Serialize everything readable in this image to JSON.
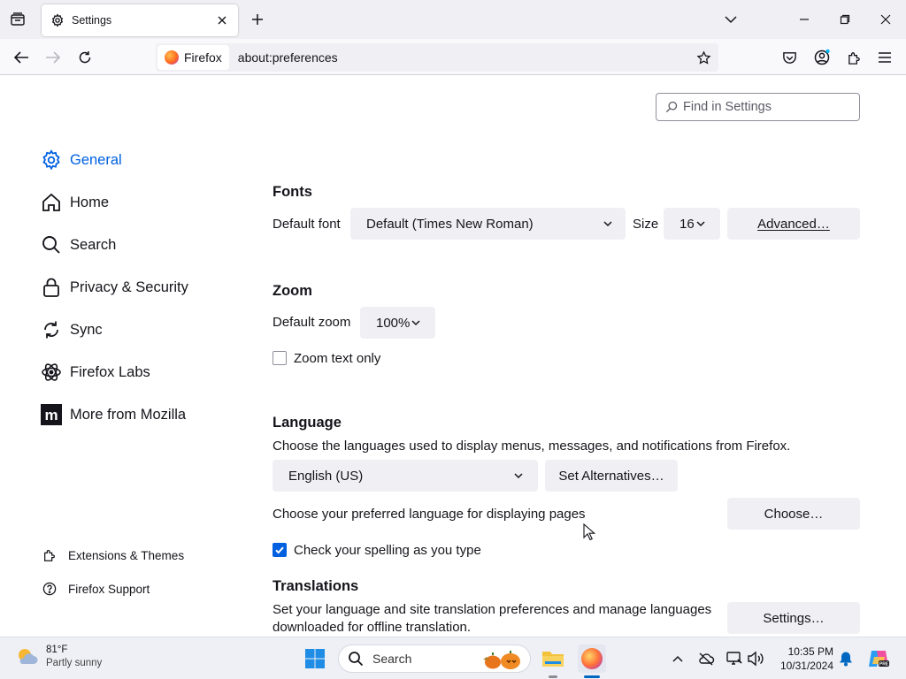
{
  "tab": {
    "title": "Settings"
  },
  "navbar": {
    "identity_label": "Firefox",
    "url": "about:preferences"
  },
  "search": {
    "placeholder": "Find in Settings"
  },
  "sidebar": {
    "categories": [
      {
        "label": "General",
        "icon": "gear-icon"
      },
      {
        "label": "Home",
        "icon": "home-icon"
      },
      {
        "label": "Search",
        "icon": "search-icon"
      },
      {
        "label": "Privacy & Security",
        "icon": "lock-icon"
      },
      {
        "label": "Sync",
        "icon": "sync-icon"
      },
      {
        "label": "Firefox Labs",
        "icon": "labs-icon"
      },
      {
        "label": "More from Mozilla",
        "icon": "mozilla-icon"
      }
    ],
    "footer": [
      {
        "label": "Extensions & Themes",
        "icon": "puzzle-icon"
      },
      {
        "label": "Firefox Support",
        "icon": "help-icon"
      }
    ]
  },
  "fonts": {
    "heading": "Fonts",
    "default_font_label": "Default font",
    "default_font_value": "Default (Times New Roman)",
    "size_label": "Size",
    "size_value": "16",
    "advanced_button": "Advanced…"
  },
  "zoom": {
    "heading": "Zoom",
    "default_zoom_label": "Default zoom",
    "default_zoom_value": "100%",
    "zoom_text_only_label": "Zoom text only",
    "zoom_text_only_checked": false
  },
  "language": {
    "heading": "Language",
    "description": "Choose the languages used to display menus, messages, and notifications from Firefox.",
    "selected_language": "English (US)",
    "set_alternatives_button": "Set Alternatives…",
    "page_language_text": "Choose your preferred language for displaying pages",
    "choose_button": "Choose…",
    "spellcheck_label": "Check your spelling as you type",
    "spellcheck_checked": true
  },
  "translations": {
    "heading": "Translations",
    "description_line1": "Set your language and site translation preferences and manage languages",
    "description_line2": "downloaded for offline translation.",
    "settings_button": "Settings…"
  },
  "taskbar": {
    "temperature": "81°F",
    "condition": "Partly sunny",
    "search_label": "Search",
    "time": "10:35 PM",
    "date": "10/31/2024"
  },
  "colors": {
    "accent": "#0061e0",
    "chrome": "#f0f0f4",
    "button": "#f0f0f4"
  }
}
